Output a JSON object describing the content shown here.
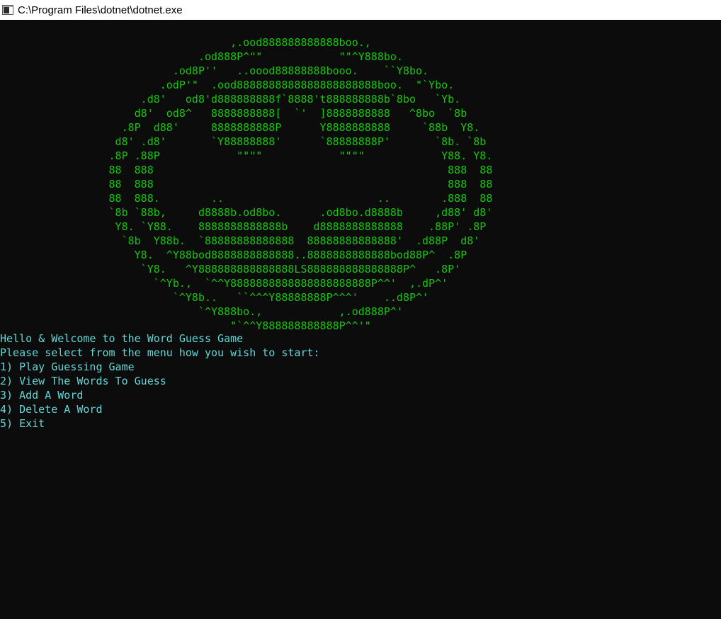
{
  "window": {
    "title": "C:\\Program Files\\dotnet\\dotnet.exe",
    "icon": "console-app-icon"
  },
  "colors": {
    "background": "#0c0c0c",
    "ascii_art": "#16c60c",
    "menu_text": "#61d6d6"
  },
  "ascii_art": [
    "                                    ,.ood888888888888boo.,",
    "                               .od888P^\"\"            \"\"^Y888bo.",
    "                           .od8P''   ..oood88888888booo.    ``Y8bo.",
    "                         .odP'\"  .ood8888888888888888888888boo.  \"`Ybo.",
    "                      .d8'   od8'd888888888f`8888't888888888b`8bo   `Yb.",
    "                     d8'  od8^   8888888888[  `'  ]8888888888   ^8bo  `8b",
    "                   .8P  d88'     8888888888P      Y8888888888     `88b  Y8.",
    "                  d8' .d8'       `Y88888888'      `88888888P'       `8b. `8b",
    "                 .8P .88P            \"\"\"\"            \"\"\"\"            Y88. Y8.",
    "                 88  888                                              888  88",
    "                 88  888                                              888  88",
    "                 88  888.        ..                        ..        .888  88",
    "                 `8b `88b,     d8888b.od8bo.      .od8bo.d8888b     ,d88' d8'",
    "                  Y8. `Y88.    8888888888888b    d8888888888888    .88P' .8P",
    "                   `8b  Y88b.  `88888888888888  88888888888888'  .d88P  d8'",
    "                     Y8.  ^Y88bod8888888888888..8888888888888bod88P^  .8P",
    "                      `Y8.   ^Y888888888888888LS888888888888888P^   .8P'",
    "                        `^Yb.,  `^^Y8888888888888888888888P^^'  ,.dP^'",
    "                           `^Y8b..   ``^^^Y88888888P^^^'    ..d8P^'",
    "                               `^Y888bo.,            ,.od888P^'",
    "                                    \"`^^Y888888888888P^^'\""
  ],
  "menu": {
    "welcome": "Hello & Welcome to the Word Guess Game",
    "prompt": "Please select from the menu how you wish to start:",
    "options": [
      "1) Play Guessing Game",
      "2) View The Words To Guess",
      "3) Add A Word",
      "4) Delete A Word",
      "5) Exit"
    ]
  }
}
